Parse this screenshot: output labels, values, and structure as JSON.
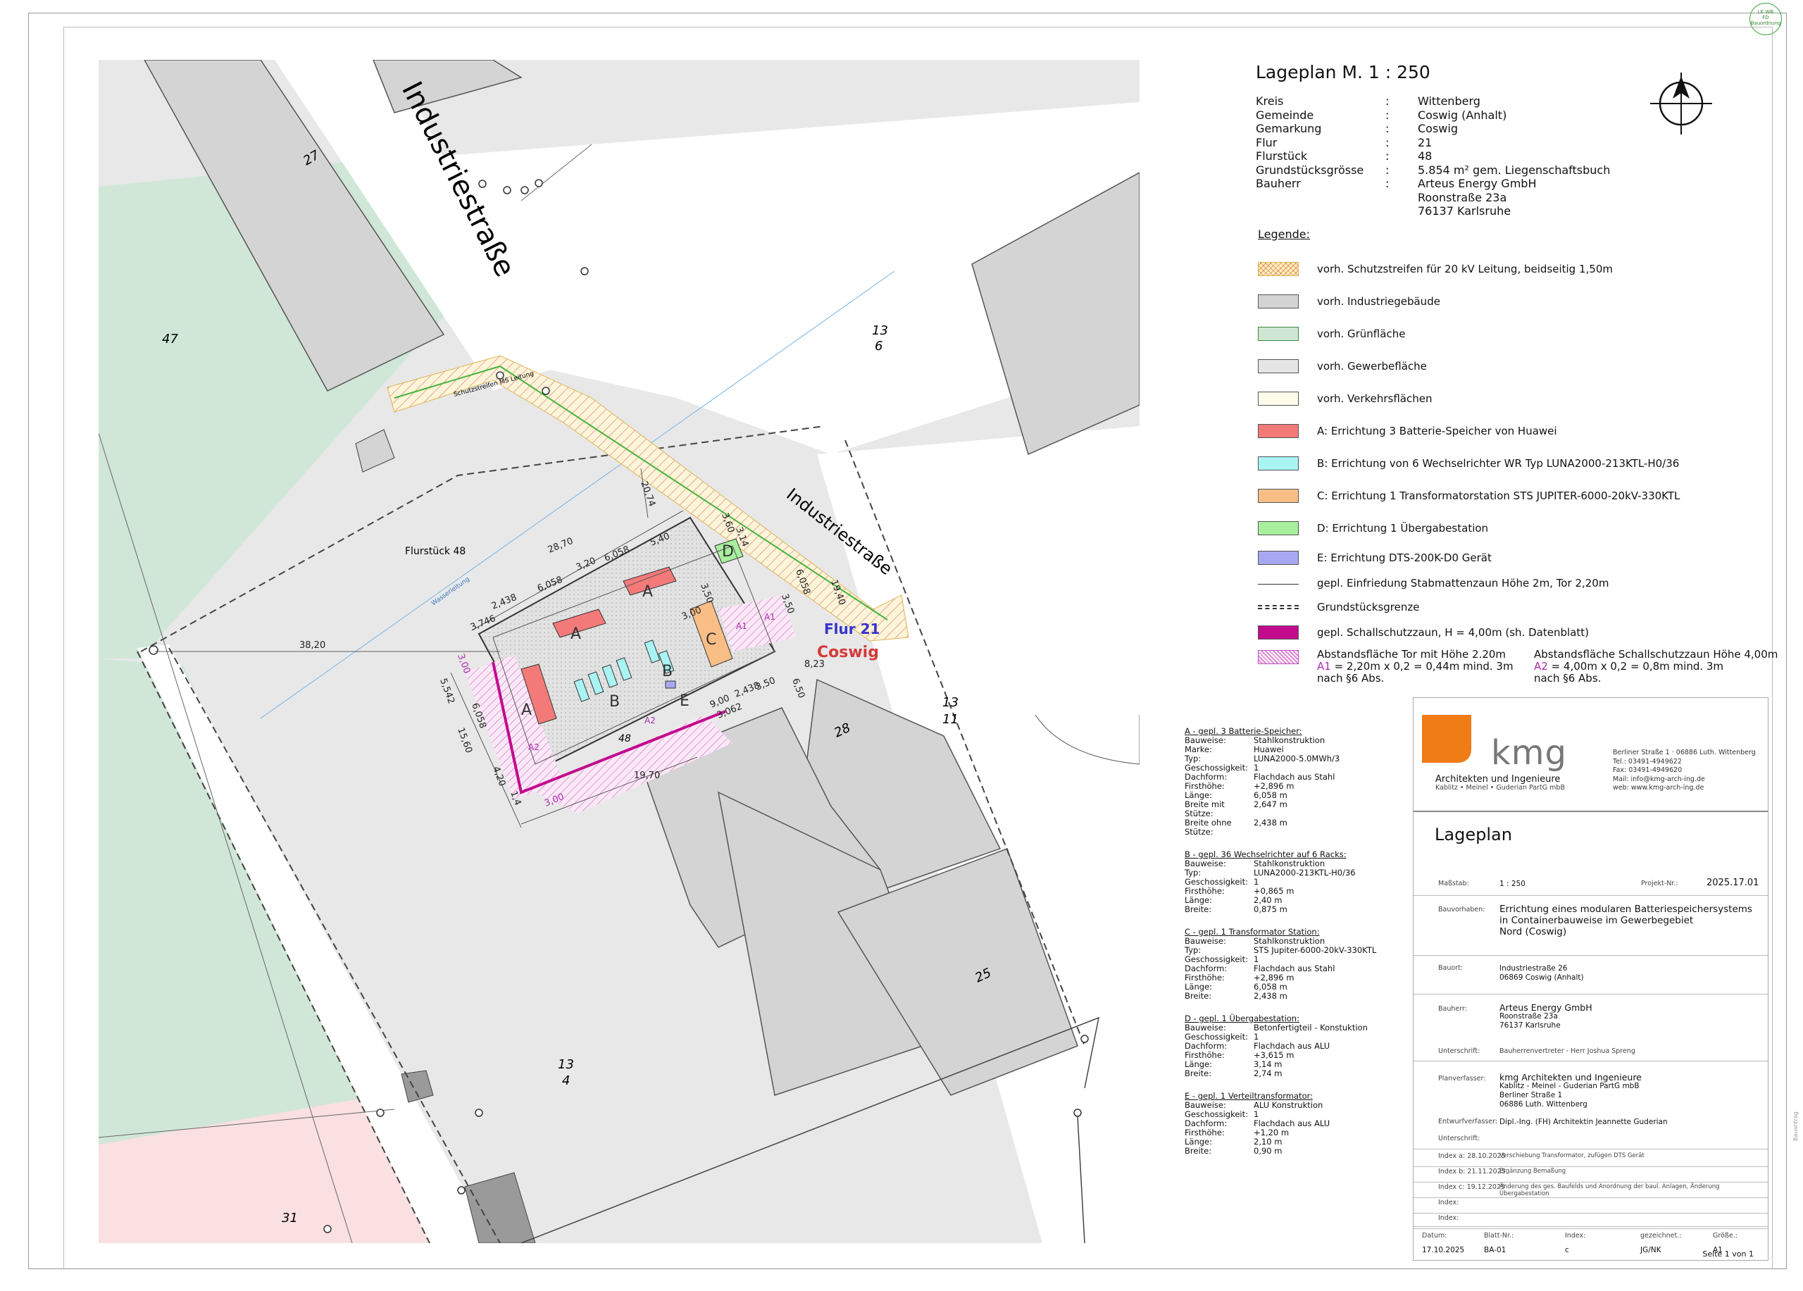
{
  "stamp": [
    "LK WB",
    "FD Bauordnung"
  ],
  "plan": {
    "street_main": "Industriestraße",
    "street_small": "Industriestraße",
    "flurstueck": "Flurstück 48",
    "parcels": [
      "27",
      "47",
      "13",
      "6",
      "13",
      "11",
      "28",
      "25",
      "31",
      "48",
      "13",
      "4"
    ],
    "flur": "Flur 21",
    "coswig": "Coswig",
    "cable": "Schutzstreifen MS Leitung",
    "water": "Wasserleitung",
    "dims": [
      "38,20",
      "28,70",
      "3,746",
      "2,438",
      "6,058",
      "3,20",
      "6,058",
      "5,40",
      "20,74",
      "19,70",
      "9,00",
      "3,062",
      "2,438",
      "3,50",
      "6,50",
      "3,60",
      "3,14",
      "3,00",
      "3,50",
      "6,058",
      "3,50",
      "4,20",
      "15,60",
      "5,542",
      "6,058",
      "1,4",
      "3,00",
      "3,00",
      "8,23",
      "19,40"
    ],
    "block_labels": [
      "A",
      "A",
      "A",
      "A",
      "B",
      "B",
      "B",
      "C",
      "D",
      "E",
      "A1",
      "A1",
      "A2",
      "A2"
    ]
  },
  "header": {
    "title": "Lageplan M.  1 : 250",
    "rows": [
      {
        "k": "Kreis",
        "v": "Wittenberg"
      },
      {
        "k": "Gemeinde",
        "v": "Coswig (Anhalt)"
      },
      {
        "k": "Gemarkung",
        "v": "Coswig"
      },
      {
        "k": "Flur",
        "v": "21"
      },
      {
        "k": "Flurstück",
        "v": "48"
      },
      {
        "k": "Grundstücksgrösse",
        "v": "5.854 m² gem. Liegenschaftsbuch"
      },
      {
        "k": "Bauherr",
        "v": "Arteus Energy GmbH"
      },
      {
        "k": "",
        "v": "Roonstraße 23a"
      },
      {
        "k": "",
        "v": "76137 Karlsruhe"
      }
    ],
    "sep": ":"
  },
  "legend": {
    "heading": "Legende:",
    "items": [
      {
        "label": "vorh. Schutzstreifen für 20 kV Leitung, beidseitig 1,50m",
        "color": "#fde8b0",
        "pattern": "hatch"
      },
      {
        "label": "vorh. Industriegebäude",
        "color": "#d4d4d4"
      },
      {
        "label": "vorh. Grünfläche",
        "color": "#cfe6d5"
      },
      {
        "label": "vorh. Gewerbefläche",
        "color": "#e5e5e5"
      },
      {
        "label": "vorh. Verkehrsflächen",
        "color": "#fdfbea"
      },
      {
        "label": "A: Errichtung 3 Batterie-Speicher von Huawei",
        "color": "#f47a7a"
      },
      {
        "label": "B: Errichtung von 6 Wechselrichter WR Typ LUNA2000-213KTL-H0/36",
        "color": "#a9f3f3"
      },
      {
        "label": "C: Errichtung 1 Transformatorstation STS JUPITER-6000-20kV-330KTL",
        "color": "#f9be86"
      },
      {
        "label": "D: Errichtung 1 Übergabestation",
        "color": "#a8ef9e"
      },
      {
        "label": "E: Errichtung DTS-200K-D0 Gerät",
        "color": "#a8a8f2"
      },
      {
        "label": "gepl. Einfriedung Stabmattenzaun Höhe 2m, Tor 2,20m",
        "pattern": "line"
      },
      {
        "label": "Grundstücksgrenze",
        "pattern": "dash"
      },
      {
        "label": "gepl. Schallschutzzaun, H = 4,00m (sh. Datenblatt)",
        "color": "#c30b8e"
      }
    ],
    "abstand1": [
      "Abstandsfläche Tor mit Höhe 2.20m",
      "A1",
      "= 2,20m x 0,2 = 0,44m mind. 3m",
      "nach §6 Abs."
    ],
    "abstand2": [
      "Abstandsfläche Schallschutzzaun Höhe 4,00m",
      "A2",
      "= 4,00m x 0,2 = 0,8m mind. 3m",
      "nach §6 Abs."
    ]
  },
  "specs": [
    {
      "title": "A - gepl. 3 Batterie-Speicher:",
      "rows": [
        [
          "Bauweise:",
          "Stahlkonstruktion"
        ],
        [
          "Marke:",
          "Huawei"
        ],
        [
          "Typ:",
          "LUNA2000-5.0MWh/3"
        ],
        [
          "Geschossigkeit:",
          "1"
        ],
        [
          "Dachform:",
          "Flachdach aus Stahl"
        ],
        [
          "Firsthöhe:",
          "+2,896 m"
        ],
        [
          "Länge:",
          "6,058 m"
        ],
        [
          "Breite mit Stütze:",
          "2,647 m"
        ],
        [
          "Breite ohne Stütze:",
          "2,438 m"
        ]
      ]
    },
    {
      "title": "B - gepl. 36 Wechselrichter auf 6 Racks:",
      "rows": [
        [
          "Bauweise:",
          "Stahlkonstruktion"
        ],
        [
          "Typ:",
          "LUNA2000-213KTL-H0/36"
        ],
        [
          "Geschossigkeit:",
          "1"
        ],
        [
          "Firsthöhe:",
          "+0,865 m"
        ],
        [
          "Länge:",
          "2,40 m"
        ],
        [
          "Breite:",
          "0,875 m"
        ]
      ]
    },
    {
      "title": "C - gepl. 1 Transformator Station:",
      "rows": [
        [
          "Bauweise:",
          "Stahlkonstruktion"
        ],
        [
          "Typ:",
          "STS Jupiter-6000-20kV-330KTL"
        ],
        [
          "Geschossigkeit:",
          "1"
        ],
        [
          "Dachform:",
          "Flachdach aus Stahl"
        ],
        [
          "Firsthöhe:",
          "+2,896 m"
        ],
        [
          "Länge:",
          "6,058 m"
        ],
        [
          "Breite:",
          "2,438 m"
        ]
      ]
    },
    {
      "title": "D - gepl. 1 Übergabestation:",
      "rows": [
        [
          "Bauweise:",
          "Betonfertigteil - Konstuktion"
        ],
        [
          "Geschossigkeit:",
          "1"
        ],
        [
          "Dachform:",
          "Flachdach aus ALU"
        ],
        [
          "Firsthöhe:",
          "+3,615 m"
        ],
        [
          "Länge:",
          "3,14 m"
        ],
        [
          "Breite:",
          "2,74 m"
        ]
      ]
    },
    {
      "title": "E - gepl. 1 Verteiltransformator:",
      "rows": [
        [
          "Bauweise:",
          "ALU Konstruktion"
        ],
        [
          "Geschossigkeit:",
          "1"
        ],
        [
          "Dachform:",
          "Flachdach aus ALU"
        ],
        [
          "Firsthöhe:",
          "+1,20 m"
        ],
        [
          "Länge:",
          "2,10 m"
        ],
        [
          "Breite:",
          "0,90 m"
        ]
      ]
    }
  ],
  "titleblock": {
    "logo": "kmg",
    "firm": "Architekten und Ingenieure",
    "firm_sub": "Kablitz • Meinel • Guderian PartG mbB",
    "address": [
      "Berliner Straße 1  ·  06886 Luth. Wittenberg",
      "Tel.: 03491-4949622",
      "Fax: 03491-4949620",
      "Mail: info@kmg-arch-ing.de",
      "web: www.kmg-arch-ing.de"
    ],
    "doc_title": "Lageplan",
    "massstab_l": "Maßstab:",
    "massstab": "1 : 250",
    "projekt_l": "Projekt-Nr.:",
    "projekt": "2025.17.01",
    "vorhaben_l": "Bauvorhaben:",
    "vorhaben": [
      "Errichtung eines modularen Batteriespeichersystems",
      "in Containerbauweise im Gewerbegebiet",
      "Nord (Coswig)"
    ],
    "bauort_l": "Bauort:",
    "bauort": [
      "Industriestraße 26",
      "06869 Coswig (Anhalt)"
    ],
    "bauherr_l": "Bauherr:",
    "bauherr": [
      "Arteus Energy GmbH",
      "Roonstraße 23a",
      "76137 Karlsruhe"
    ],
    "unterschrift_l": "Unterschrift:",
    "unterschrift": "Bauherrenvertreter - Herr Joshua Spreng",
    "planverfasser_l": "Planverfasser:",
    "planverfasser": [
      "kmg Architekten und Ingenieure",
      "Kablitz - Meinel - Guderian PartG mbB",
      "Berliner Straße 1",
      "06886 Luth. Wittenberg"
    ],
    "entwurf_l": "Entwurfverfasser:",
    "entwurf": "Dipl.-Ing. (FH) Architektin Jeannette Guderian",
    "unterschrift2_l": "Unterschrift:",
    "index": [
      {
        "k": "Index a: 28.10.2025",
        "v": "Verschiebung Transformator, zufügen DTS Gerät"
      },
      {
        "k": "Index b: 21.11.2025",
        "v": "Ergänzung Bemaßung"
      },
      {
        "k": "Index c: 19.12.2025",
        "v": "Änderung des ges. Baufelds und Anordnung der baul. Anlagen, Änderung Übergabestation"
      },
      {
        "k": "Index:",
        "v": ""
      },
      {
        "k": "Index:",
        "v": ""
      }
    ],
    "foot_labels": [
      "Datum:",
      "Blatt-Nr.:",
      "Index:",
      "gezeichnet.:",
      "Größe.:"
    ],
    "foot_vals": [
      "17.10.2025",
      "BA-01",
      "c",
      "JG/NK",
      "A1"
    ],
    "seite": "Seite 1 von 1"
  }
}
